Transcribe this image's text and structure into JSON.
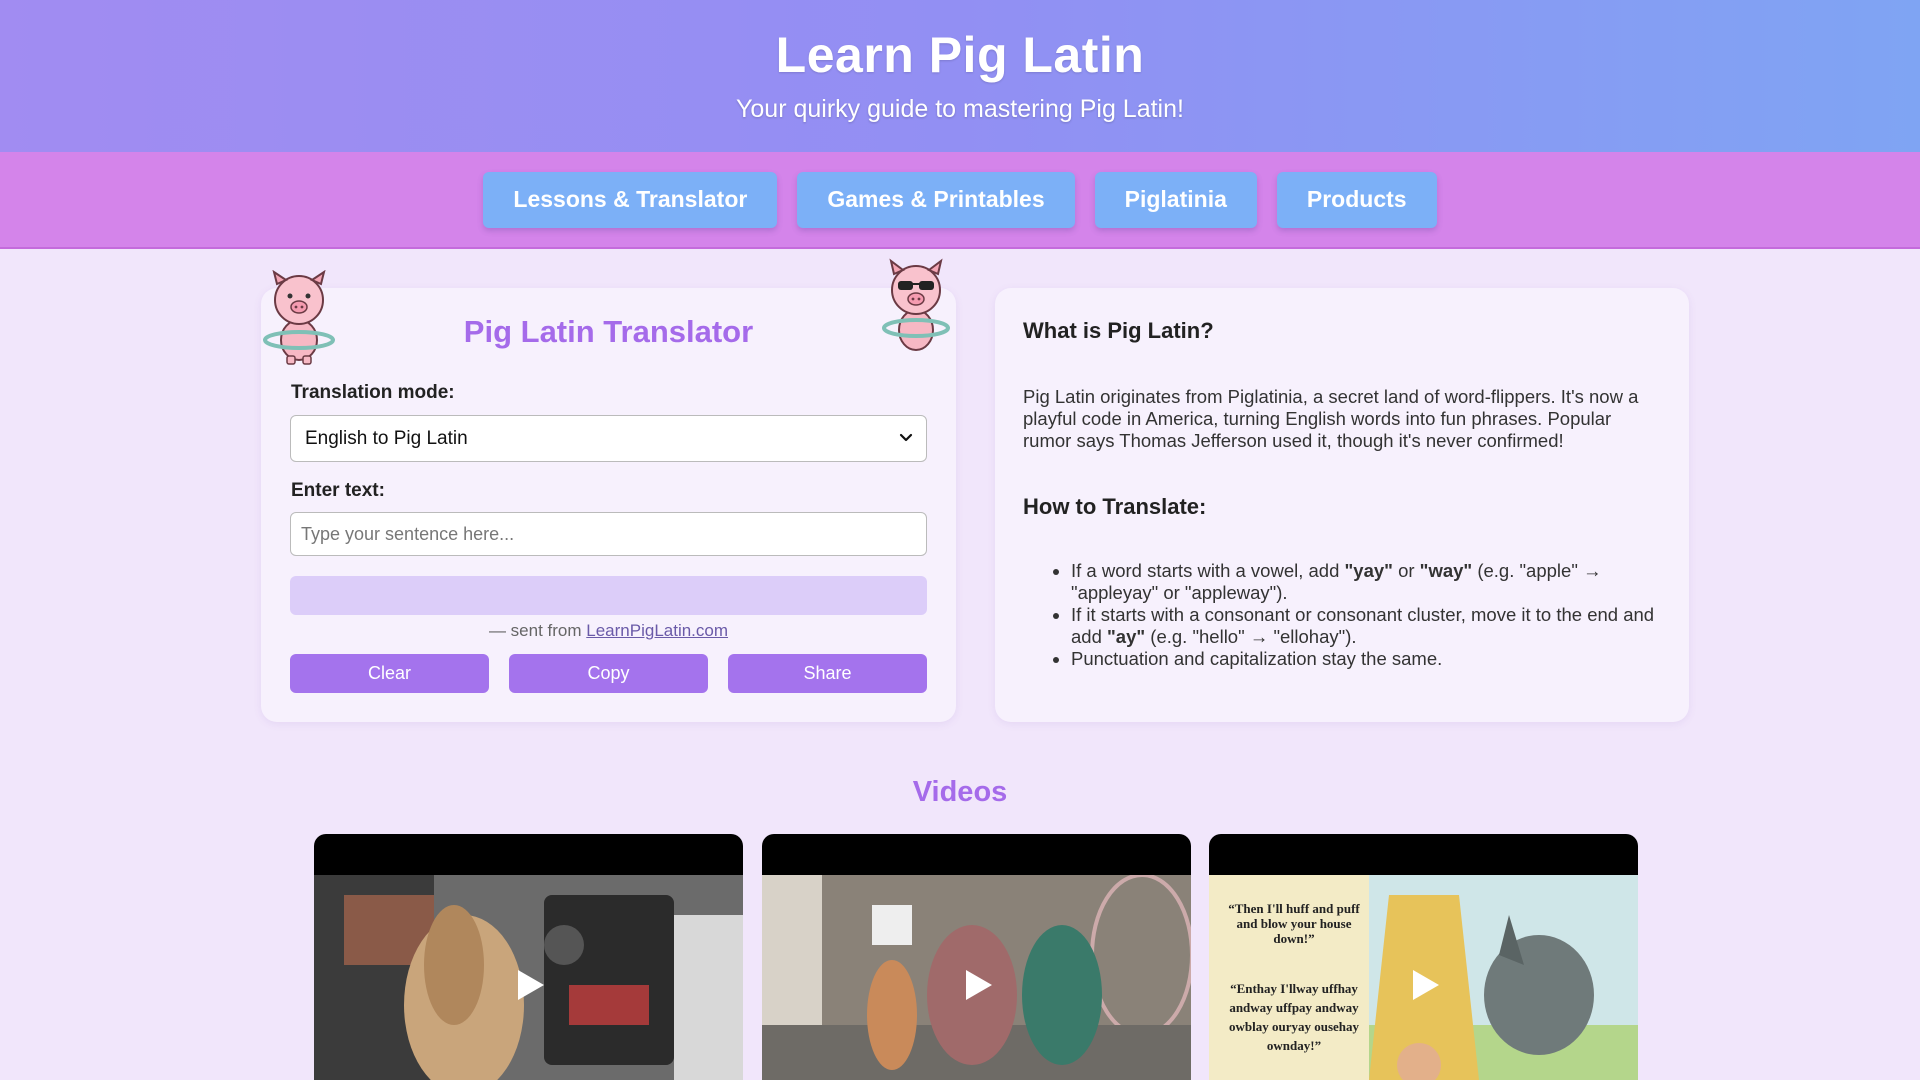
{
  "header": {
    "title": "Learn Pig Latin",
    "subtitle": "Your quirky guide to mastering Pig Latin!"
  },
  "nav": {
    "items": [
      {
        "label": "Lessons & Translator"
      },
      {
        "label": "Games & Printables"
      },
      {
        "label": "Piglatinia"
      },
      {
        "label": "Products"
      }
    ]
  },
  "translator": {
    "title": "Pig Latin Translator",
    "mode_label": "Translation mode:",
    "mode_value": "English to Pig Latin",
    "text_label": "Enter text:",
    "text_placeholder": "Type your sentence here...",
    "sent_prefix": "— sent from ",
    "sent_link": "LearnPigLatin.com",
    "buttons": {
      "clear": "Clear",
      "copy": "Copy",
      "share": "Share"
    }
  },
  "info": {
    "heading1": "What is Pig Latin?",
    "paragraph": "Pig Latin originates from Piglatinia, a secret land of word-flippers. It's now a playful code in America, turning English words into fun phrases. Popular rumor says Thomas Jefferson used it, though it's never confirmed!",
    "heading2": "How to Translate:",
    "rules": [
      {
        "a": "If a word starts with a vowel, add ",
        "b1": "\"yay\"",
        "c": " or ",
        "b2": "\"way\"",
        "d": " (e.g. \"apple\" → \"appleyay\" or \"appleway\")."
      },
      {
        "a": "If it starts with a consonant or consonant cluster, move it to the end and add ",
        "b1": "\"ay\"",
        "d": " (e.g. \"hello\" → \"ellohay\")."
      },
      {
        "a": "Punctuation and capitalization stay the same."
      }
    ]
  },
  "videos": {
    "title": "Videos",
    "items": [
      {
        "icon": "play-icon"
      },
      {
        "icon": "play-icon"
      },
      {
        "icon": "play-icon",
        "quote1": "“Then I'll huff and puff and blow your house down!”",
        "quote2": "“Enthay I'llway uffhay andway uffpay andway owblay ouryay ousehay ownday!”"
      }
    ]
  },
  "colors": {
    "accent": "#a56bea",
    "nav_bg": "#d484ea",
    "nav_button": "#7cb0f7",
    "page_bg": "#f1e6fb"
  }
}
